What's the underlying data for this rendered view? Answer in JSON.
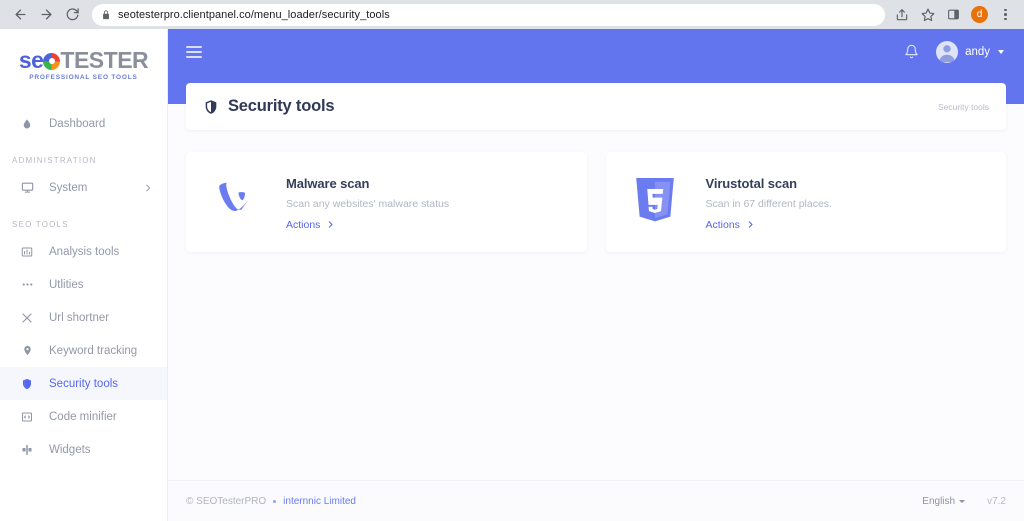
{
  "browser": {
    "url": "seotesterpro.clientpanel.co/menu_loader/security_tools",
    "back_icon": "back-arrow-icon",
    "forward_icon": "forward-arrow-icon",
    "reload_icon": "reload-icon",
    "lock_icon": "lock-icon",
    "share_icon": "share-icon",
    "bookmark_icon": "star-icon",
    "sidepanel_icon": "side-panel-icon",
    "profile_initial": "d",
    "menu_icon": "kebab-menu-icon"
  },
  "sidebar": {
    "logo": {
      "part1": "se",
      "part2": "TESTER",
      "tagline": "PROFESSIONAL SEO TOOLS"
    },
    "items": [
      {
        "label": "Dashboard",
        "icon": "droplet-icon",
        "active": false,
        "type": "item"
      },
      {
        "label": "ADMINISTRATION",
        "type": "section"
      },
      {
        "label": "System",
        "icon": "monitor-icon",
        "active": false,
        "type": "item",
        "chevron": true
      },
      {
        "label": "SEO TOOLS",
        "type": "section"
      },
      {
        "label": "Analysis tools",
        "icon": "chart-icon",
        "active": false,
        "type": "item"
      },
      {
        "label": "Utlities",
        "icon": "ellipsis-icon",
        "active": false,
        "type": "item"
      },
      {
        "label": "Url shortner",
        "icon": "scissors-icon",
        "active": false,
        "type": "item"
      },
      {
        "label": "Keyword tracking",
        "icon": "map-pin-icon",
        "active": false,
        "type": "item"
      },
      {
        "label": "Security tools",
        "icon": "shield-icon",
        "active": true,
        "type": "item"
      },
      {
        "label": "Code minifier",
        "icon": "image-code-icon",
        "active": false,
        "type": "item"
      },
      {
        "label": "Widgets",
        "icon": "widgets-icon",
        "active": false,
        "type": "item"
      }
    ]
  },
  "topbar": {
    "menu_toggle_icon": "hamburger-icon",
    "notification_icon": "bell-icon",
    "user_name": "andy",
    "avatar_icon": "user-avatar-icon"
  },
  "page": {
    "title": "Security tools",
    "title_icon": "shield-icon",
    "breadcrumb": "Security tools"
  },
  "cards": [
    {
      "icon": "typo3-logo-icon",
      "title": "Malware scan",
      "description": "Scan any websites' malware status",
      "action_label": "Actions",
      "action_icon": "chevron-right-icon"
    },
    {
      "icon": "css3-shield-icon",
      "title": "Virustotal scan",
      "description": "Scan in 67 different places.",
      "action_label": "Actions",
      "action_icon": "chevron-right-icon"
    }
  ],
  "footer": {
    "copyright": "© SEOTesterPRO",
    "company_link": "internnic Limited",
    "language": "English",
    "version": "v7.2"
  },
  "colors": {
    "brand_purple": "#6275ef",
    "accent_link": "#5566ef",
    "sidebar_bg": "#ffffff",
    "content_bg": "#fcfcfe"
  }
}
